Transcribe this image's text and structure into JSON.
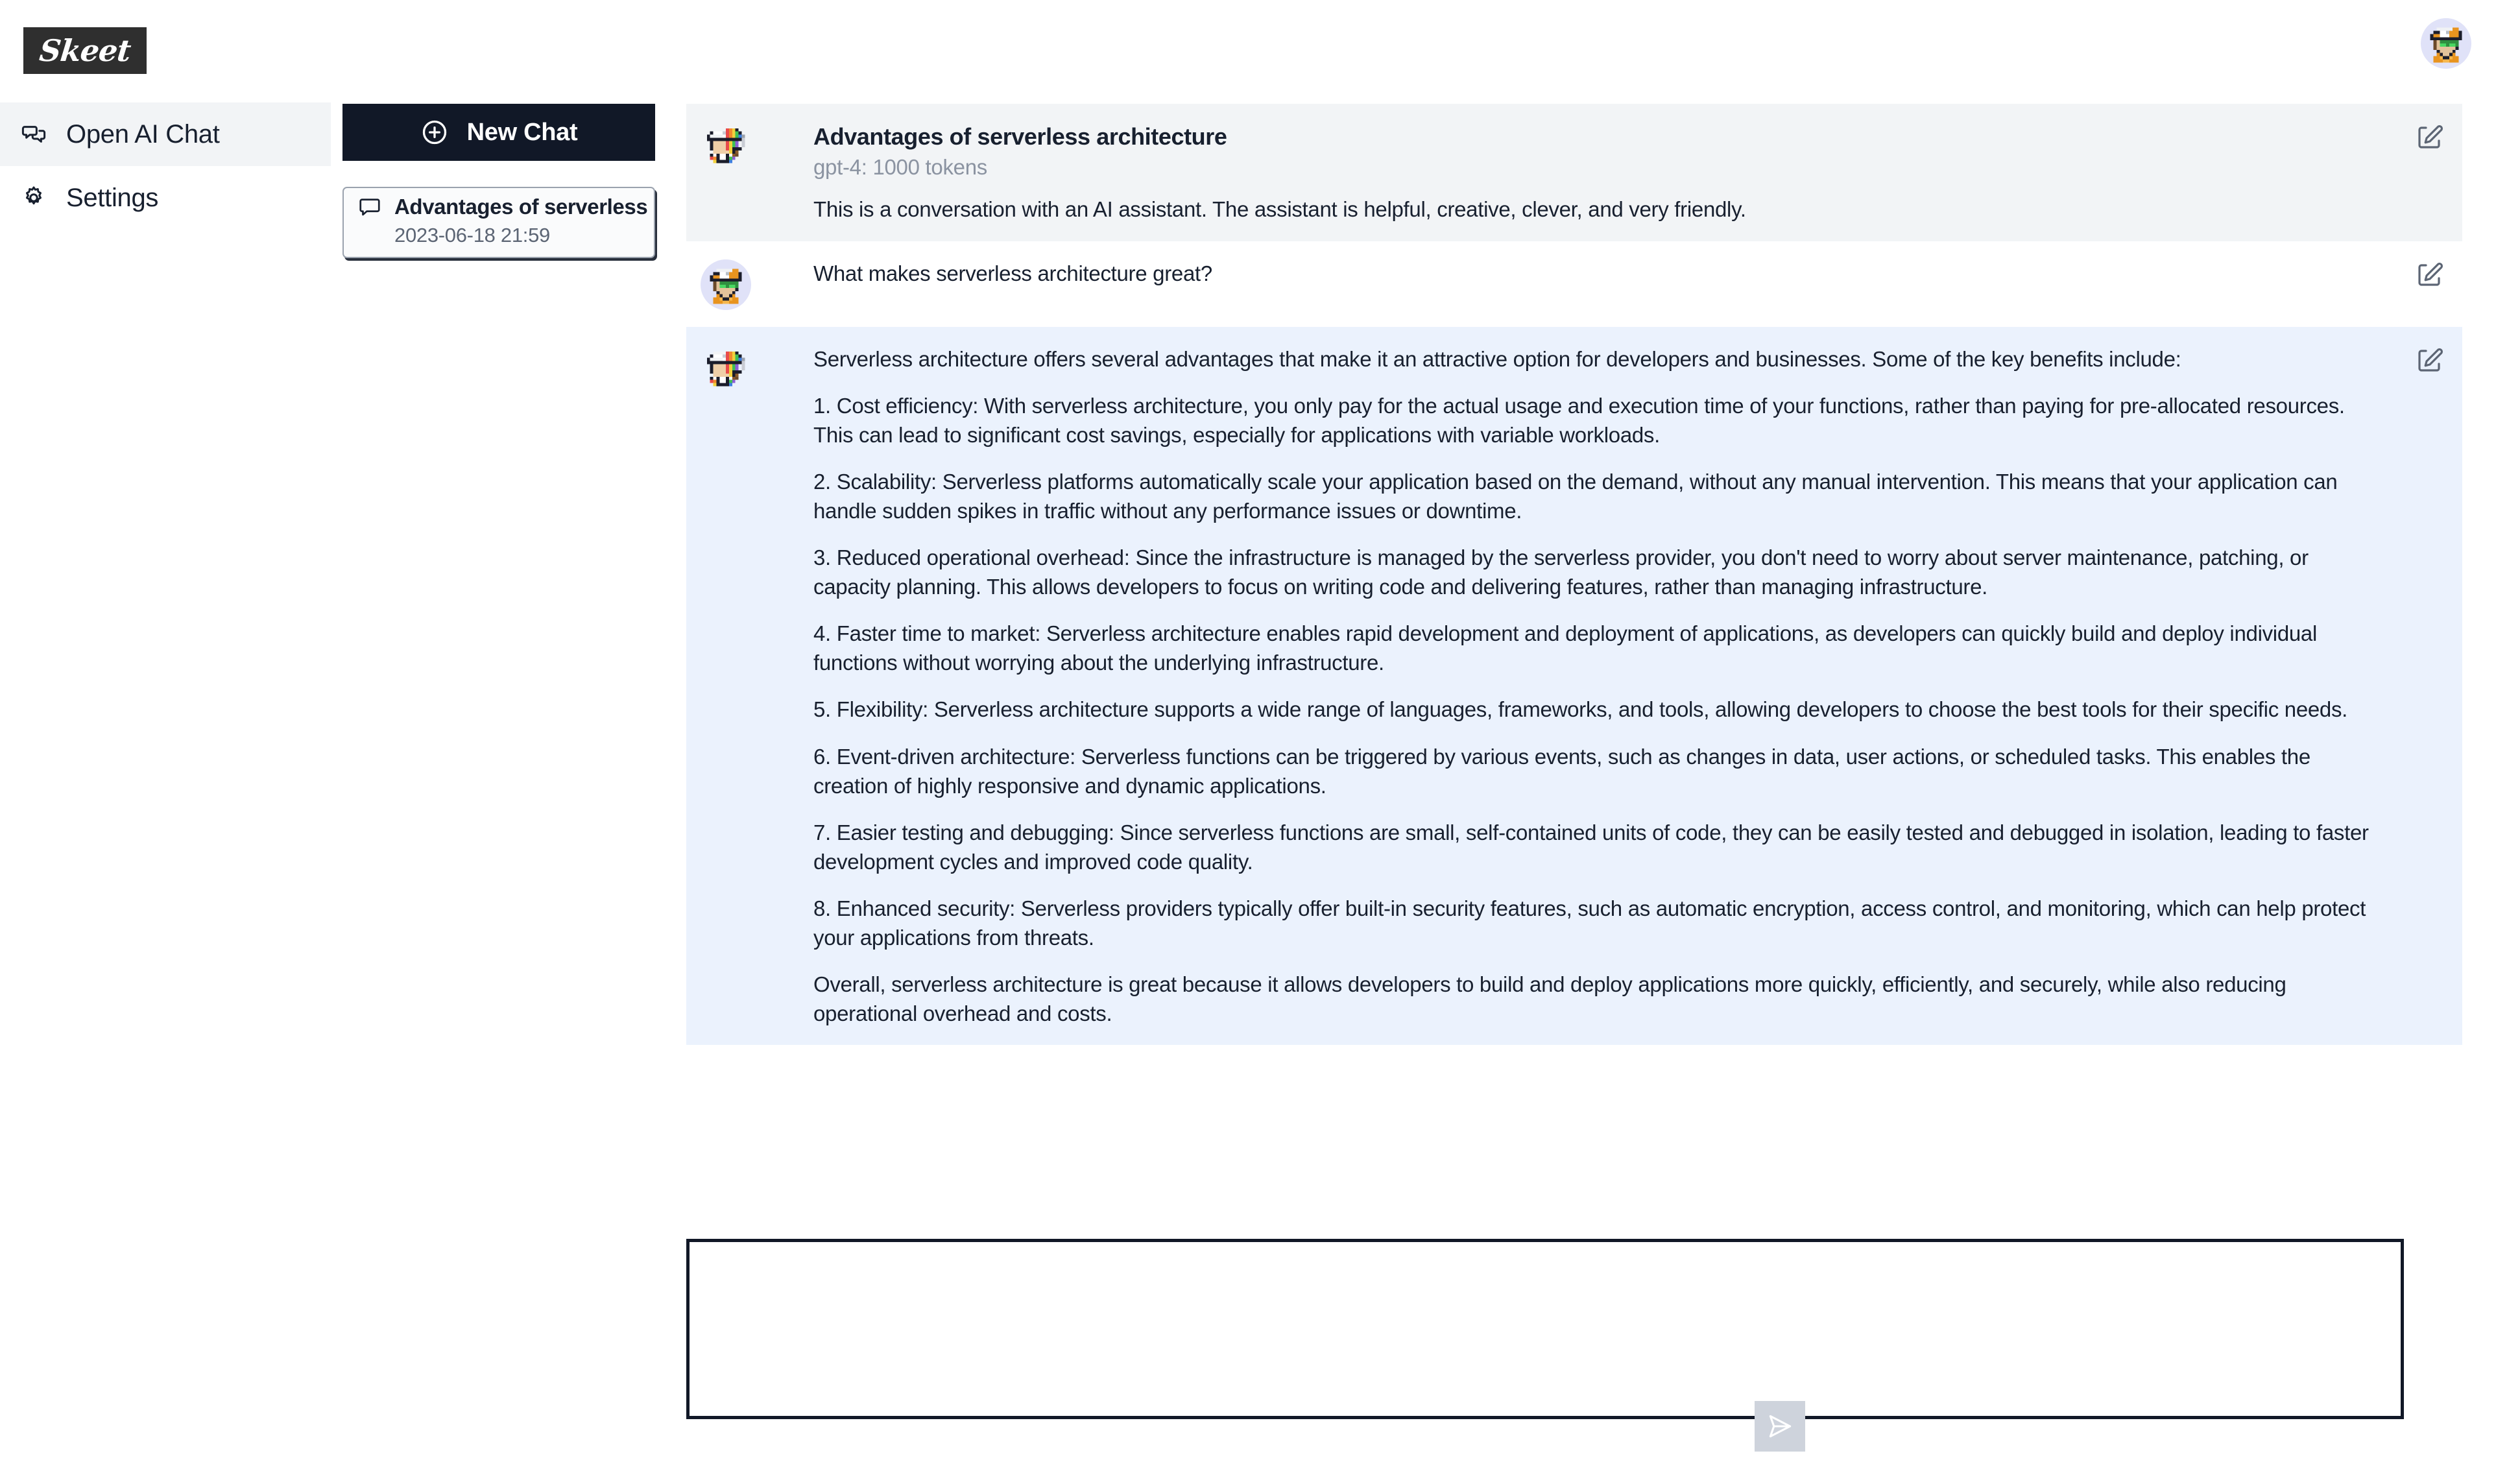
{
  "brand": {
    "logo_text": "Skeet"
  },
  "sidebar": {
    "items": [
      {
        "label": "Open AI Chat",
        "icon": "chat-bubbles-icon",
        "active": true
      },
      {
        "label": "Settings",
        "icon": "gear-icon",
        "active": false
      }
    ]
  },
  "chat_list": {
    "new_chat_label": "New Chat",
    "new_chat_icon": "plus-circle-icon",
    "items": [
      {
        "icon": "chat-bubble-icon",
        "title": "Advantages of serverless architecture",
        "date": "2023-06-18 21:59"
      }
    ]
  },
  "conversation": {
    "title": "Advantages of serverless architecture",
    "meta": "gpt-4: 1000 tokens",
    "system_prompt": "This is a conversation with an AI assistant. The assistant is helpful, creative, clever, and very friendly.",
    "user_message": "What makes serverless architecture great?",
    "assistant_paragraphs": [
      "Serverless architecture offers several advantages that make it an attractive option for developers and businesses. Some of the key benefits include:",
      "1. Cost efficiency: With serverless architecture, you only pay for the actual usage and execution time of your functions, rather than paying for pre-allocated resources. This can lead to significant cost savings, especially for applications with variable workloads.",
      "2. Scalability: Serverless platforms automatically scale your application based on the demand, without any manual intervention. This means that your application can handle sudden spikes in traffic without any performance issues or downtime.",
      "3. Reduced operational overhead: Since the infrastructure is managed by the serverless provider, you don't need to worry about server maintenance, patching, or capacity planning. This allows developers to focus on writing code and delivering features, rather than managing infrastructure.",
      "4. Faster time to market: Serverless architecture enables rapid development and deployment of applications, as developers can quickly build and deploy individual functions without worrying about the underlying infrastructure.",
      "5. Flexibility: Serverless architecture supports a wide range of languages, frameworks, and tools, allowing developers to choose the best tools for their specific needs.",
      "6. Event-driven architecture: Serverless functions can be triggered by various events, such as changes in data, user actions, or scheduled tasks. This enables the creation of highly responsive and dynamic applications.",
      "7. Easier testing and debugging: Since serverless functions are small, self-contained units of code, they can be easily tested and debugged in isolation, leading to faster development cycles and improved code quality.",
      "8. Enhanced security: Serverless providers typically offer built-in security features, such as automatic encryption, access control, and monitoring, which can help protect your applications from threats.",
      "Overall, serverless architecture is great because it allows developers to build and deploy applications more quickly, efficiently, and securely, while also reducing operational overhead and costs."
    ],
    "edit_icon": "edit-pencil-icon"
  },
  "composer": {
    "value": "",
    "placeholder": "",
    "send_icon": "send-paper-plane-icon"
  },
  "avatars": {
    "assistant": "rainbow-cap-pixel-avatar",
    "user": "orange-cap-sunglasses-pixel-avatar",
    "account": "orange-cap-sunglasses-pixel-avatar"
  },
  "colors": {
    "brand_dark": "#111827",
    "system_bg": "#f2f4f6",
    "assistant_bg": "#ebf2fd",
    "avatar_circle": "#e0e2f8",
    "send_btn_bg": "#ced3dc",
    "muted_text": "#8b93a1"
  }
}
